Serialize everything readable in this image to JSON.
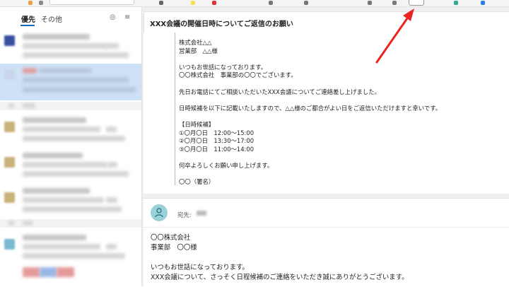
{
  "left_pane": {
    "tabs": {
      "focused": "優先",
      "other": "その他"
    }
  },
  "message": {
    "subject": "XXX会議の開催日時についてご返信のお願い",
    "quoted_lines": [
      "株式会社△△",
      "営業部　△△様",
      "",
      "いつもお世話になっております。",
      "〇〇株式会社　事業部の〇〇でございます。",
      "",
      "先日お電話にてご相談いただいたXXX会議についてご連絡差し上げました。",
      "",
      "日時候補を以下に記載いたしますので、△△様のご都合がよい日をご返信いただけますと幸いです。",
      "",
      "【日時候補】",
      "①〇月〇日　12:00～15:00",
      "②〇月〇日　13:30～17:00",
      "③〇月〇日　11:00～14:00",
      "",
      "何卒よろしくお願い申し上げます。",
      "",
      "〇〇（署名）"
    ]
  },
  "reply": {
    "to_label": "宛先:",
    "body_lines": [
      "〇〇株式会社",
      "事業部　〇〇様",
      "",
      "いつもお世話になっております。",
      "XXX会議について、さっそく日程候補のご連絡をいただき誠にありがとうございます。"
    ]
  },
  "colors": {
    "accent": "#0f6cbd",
    "selected_row": "#cfe1f6",
    "annotation_arrow": "#e8251f"
  }
}
